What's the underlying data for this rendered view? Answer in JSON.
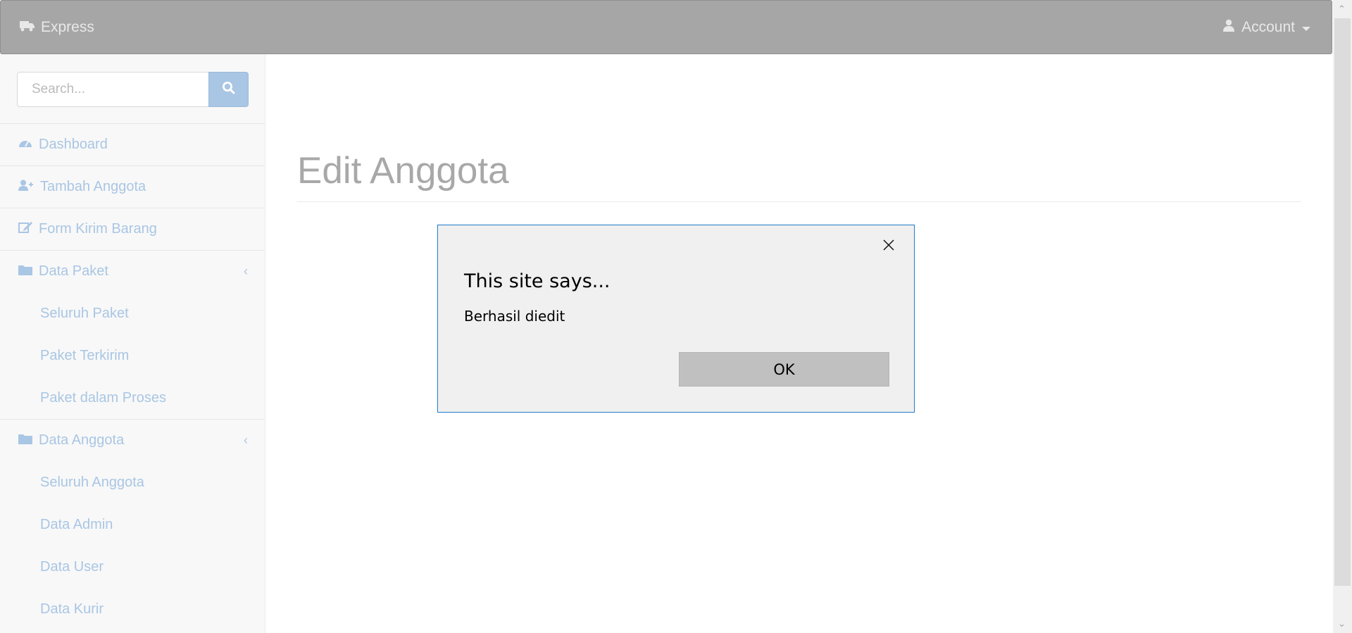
{
  "navbar": {
    "brand": "Express",
    "brand_icon": "truck-icon",
    "account_label": "Account",
    "account_icon": "user-icon"
  },
  "sidebar": {
    "search_placeholder": "Search...",
    "search_value": "",
    "menu": {
      "dashboard": "Dashboard",
      "tambah_anggota": "Tambah Anggota",
      "form_kirim_barang": "Form Kirim Barang",
      "data_paket": "Data Paket",
      "data_paket_items": [
        "Seluruh Paket",
        "Paket Terkirim",
        "Paket dalam Proses"
      ],
      "data_anggota": "Data Anggota",
      "data_anggota_items": [
        "Seluruh Anggota",
        "Data Admin",
        "Data User",
        "Data Kurir"
      ]
    }
  },
  "main": {
    "page_title": "Edit Anggota"
  },
  "dialog": {
    "title": "This site says...",
    "message": "Berhasil diedit",
    "ok_label": "OK"
  },
  "colors": {
    "navbar_bg": "#a6a6a6",
    "link": "#a9c6e4",
    "dialog_border": "#1e7ac9"
  }
}
